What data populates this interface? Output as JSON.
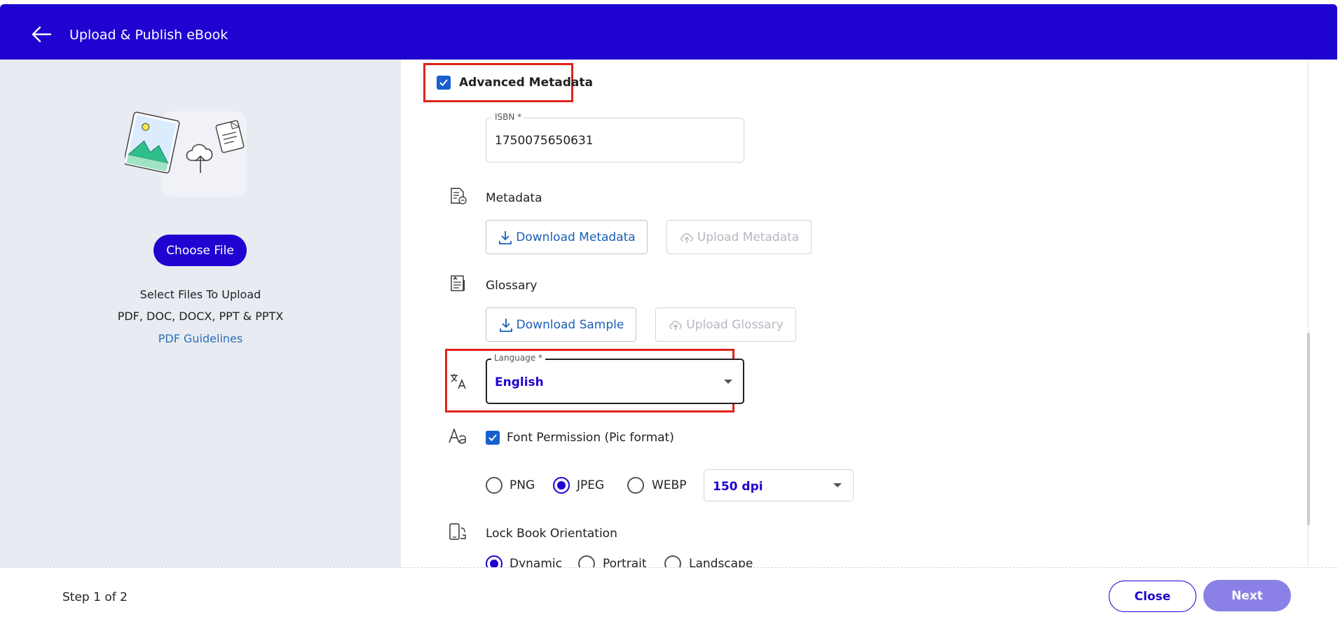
{
  "header": {
    "title": "Upload & Publish eBook"
  },
  "left_panel": {
    "choose_file_label": "Choose File",
    "select_files_text": "Select Files To Upload",
    "formats_text": "PDF, DOC, DOCX, PPT & PPTX",
    "guidelines_link": "PDF Guidelines"
  },
  "main": {
    "advanced_metadata": {
      "label": "Advanced Metadata",
      "checked": true
    },
    "isbn": {
      "legend": "ISBN *",
      "value": "1750075650631"
    },
    "metadata": {
      "label": "Metadata",
      "download_label": "Download Metadata",
      "upload_label": "Upload Metadata"
    },
    "glossary": {
      "label": "Glossary",
      "download_label": "Download Sample",
      "upload_label": "Upload Glossary"
    },
    "language": {
      "legend": "Language *",
      "value": "English"
    },
    "font_permission": {
      "label": "Font Permission (Pic format)",
      "checked": true,
      "formats": [
        "PNG",
        "JPEG",
        "WEBP"
      ],
      "selected_format": "JPEG",
      "dpi_value": "150 dpi"
    },
    "orientation": {
      "label": "Lock Book Orientation",
      "options": [
        "Dynamic",
        "Portrait",
        "Landscape"
      ],
      "selected": "Dynamic"
    }
  },
  "footer": {
    "step_text": "Step 1 of 2",
    "close_label": "Close",
    "next_label": "Next"
  },
  "colors": {
    "brand": "#1f03d1",
    "highlight": "#e0231b",
    "checkbox": "#1a5fd0",
    "link": "#2c6fb7",
    "next_disabled": "#8a80e6"
  }
}
